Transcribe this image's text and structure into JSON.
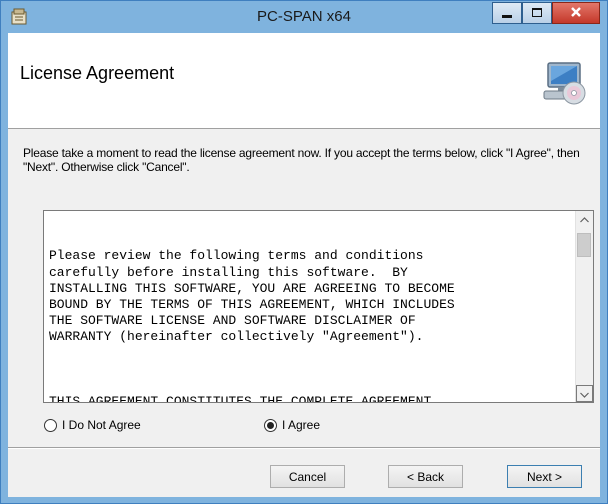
{
  "window": {
    "title": "PC-SPAN x64"
  },
  "header": {
    "title": "License Agreement"
  },
  "instructions": "Please take a moment to read the license agreement now. If you accept the terms below, click \"I Agree\", then \"Next\". Otherwise click \"Cancel\".",
  "license": {
    "paragraphs": [
      "Please review the following terms and conditions\ncarefully before installing this software.  BY\nINSTALLING THIS SOFTWARE, YOU ARE AGREEING TO BECOME\nBOUND BY THE TERMS OF THIS AGREEMENT, WHICH INCLUDES\nTHE SOFTWARE LICENSE AND SOFTWARE DISCLAIMER OF\nWARRANTY (hereinafter collectively \"Agreement\").",
      "THIS AGREEMENT CONSTITUTES THE COMPLETE AGREEMENT\nBETWEEN YOU AND THE CHICAGO MERCANTILE EXCHANGE.  IF\nYOU DO NOT AGREE TO THE TERMS OF THIS AGREEMENT, DO NOT"
    ]
  },
  "options": {
    "disagree_label": "I Do Not Agree",
    "agree_label": "I Agree",
    "selected": "agree"
  },
  "buttons": {
    "cancel": "Cancel",
    "back": "< Back",
    "next": "Next >"
  },
  "icons": {
    "app": "installer-icon",
    "header": "computer-disc-icon",
    "minimize": "minimize-icon",
    "maximize": "maximize-icon",
    "close": "close-icon",
    "scroll_up": "chevron-up-icon",
    "scroll_down": "chevron-down-icon"
  },
  "colors": {
    "frame": "#7fb3de",
    "close_button": "#c4382a",
    "header_background": "#ffffff",
    "client_background": "#f0f0f0"
  }
}
